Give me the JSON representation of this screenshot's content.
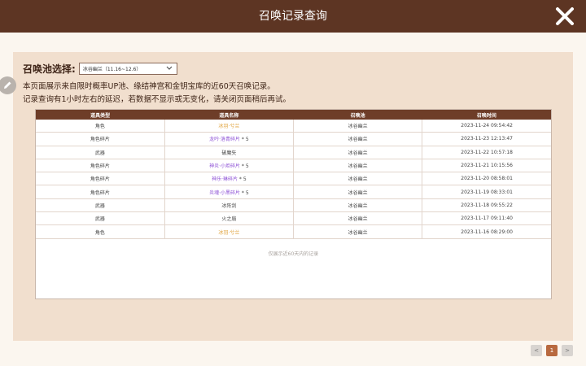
{
  "header": {
    "title": "召唤记录查询"
  },
  "pool": {
    "label": "召唤池选择:",
    "selected": "冰谷幽兰（11.16~12.6）"
  },
  "notice": {
    "line1": "本页面展示来自限时概率UP池、缘结神宫和金钥宝库的近60天召唤记录。",
    "line2": "记录查询有1小时左右的延迟，若数据不显示或无变化，请关闭页面稍后再试。"
  },
  "table": {
    "headers": [
      "道具类型",
      "道具名称",
      "召唤池",
      "召唤时间"
    ],
    "rows": [
      {
        "type": "角色",
        "name": "冰羽·兮兰",
        "count": "",
        "rarity": "gold",
        "pool": "冰谷幽兰",
        "time": "2023-11-24 09:54:42"
      },
      {
        "type": "角色碎片",
        "name": "龙吟·洛青碎片",
        "count": "* 5",
        "rarity": "purple",
        "pool": "冰谷幽兰",
        "time": "2023-11-23 12:13:47"
      },
      {
        "type": "武器",
        "name": "破魔矢",
        "count": "",
        "rarity": "normal",
        "pool": "冰谷幽兰",
        "time": "2023-11-22 10:57:18"
      },
      {
        "type": "角色碎片",
        "name": "神炎·小炬碎片",
        "count": "* 5",
        "rarity": "purple",
        "pool": "冰谷幽兰",
        "time": "2023-11-21 10:15:56"
      },
      {
        "type": "角色碎片",
        "name": "神乐·琳碎片",
        "count": "* 5",
        "rarity": "purple",
        "pool": "冰谷幽兰",
        "time": "2023-11-20 08:58:01"
      },
      {
        "type": "角色碎片",
        "name": "炎魂·小黑碎片",
        "count": "* 5",
        "rarity": "purple",
        "pool": "冰谷幽兰",
        "time": "2023-11-19 08:33:01"
      },
      {
        "type": "武器",
        "name": "冰阵剑",
        "count": "",
        "rarity": "normal",
        "pool": "冰谷幽兰",
        "time": "2023-11-18 09:55:22"
      },
      {
        "type": "武器",
        "name": "火之扇",
        "count": "",
        "rarity": "normal",
        "pool": "冰谷幽兰",
        "time": "2023-11-17 09:11:40"
      },
      {
        "type": "角色",
        "name": "冰羽·兮兰",
        "count": "",
        "rarity": "gold",
        "pool": "冰谷幽兰",
        "time": "2023-11-16 08:29:00"
      }
    ],
    "footnote": "仅展示近60天内的记录"
  },
  "pagination": {
    "prev": "<",
    "current": "1",
    "next": ">"
  },
  "colors": {
    "header_bg": "#5d3523",
    "panel_bg": "#f1dfce",
    "gold": "#e0a23a",
    "purple": "#8e52d6",
    "active_page": "#b8693f"
  },
  "icons": {
    "close": "close-icon",
    "chevron": "chevron-down-icon",
    "edit": "pencil-icon"
  }
}
